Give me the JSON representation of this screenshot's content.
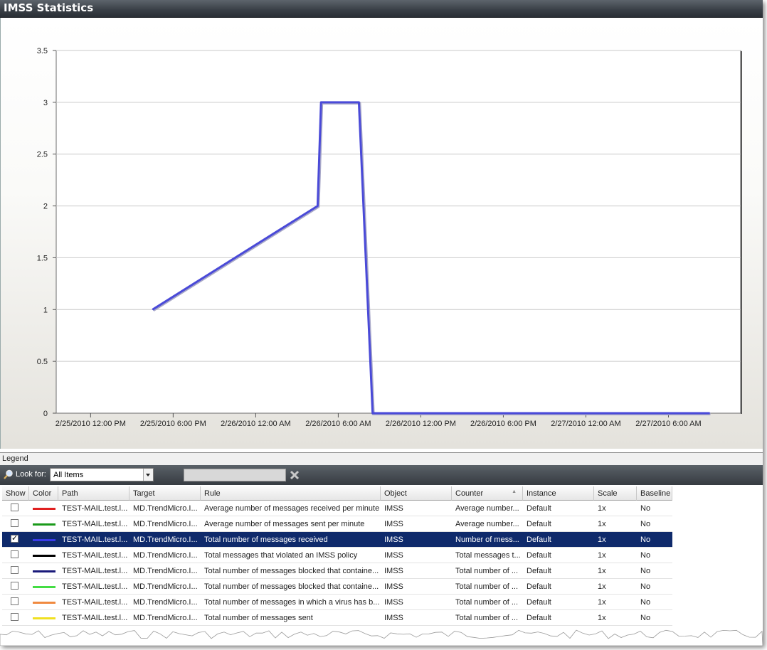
{
  "window": {
    "title": "IMSS Statistics"
  },
  "chart_data": {
    "type": "line",
    "ylim": [
      0,
      3.5
    ],
    "yticks": [
      "0",
      "0.5",
      "1",
      "1.5",
      "2",
      "2.5",
      "3",
      "3.5"
    ],
    "xticks": [
      "2/25/2010 12:00 PM",
      "2/25/2010 6:00 PM",
      "2/26/2010 12:00 AM",
      "2/26/2010 6:00 AM",
      "2/26/2010 12:00 PM",
      "2/26/2010 6:00 PM",
      "2/27/2010 12:00 AM",
      "2/27/2010 6:00 AM"
    ],
    "grid": true,
    "series": [
      {
        "color": "#4a4ad8",
        "points": [
          {
            "x": "2/25/2010 4:30 PM",
            "y": 1
          },
          {
            "x": "2/26/2010 4:30 AM",
            "y": 2
          },
          {
            "x": "2/26/2010 4:45 AM",
            "y": 3
          },
          {
            "x": "2/26/2010 7:30 AM",
            "y": 3
          },
          {
            "x": "2/26/2010 8:30 AM",
            "y": 0
          },
          {
            "x": "2/27/2010 9:00 AM",
            "y": 0
          }
        ]
      }
    ]
  },
  "legend": {
    "title": "Legend",
    "look_for_label": "Look for:",
    "filter_value": "All Items",
    "search_value": ""
  },
  "table": {
    "columns": [
      "Show",
      "Color",
      "Path",
      "Target",
      "Rule",
      "Object",
      "Counter",
      "Instance",
      "Scale",
      "Baseline"
    ],
    "rows": [
      {
        "show": false,
        "color": "#e02020",
        "path": "TEST-MAIL.test.l...",
        "target": "MD.TrendMicro.I...",
        "rule": "Average number of messages received per minute",
        "object": "IMSS",
        "counter": "Average number...",
        "instance": "Default",
        "scale": "1x",
        "baseline": "No"
      },
      {
        "show": false,
        "color": "#1a9a1a",
        "path": "TEST-MAIL.test.l...",
        "target": "MD.TrendMicro.I...",
        "rule": "Average number of messages sent per minute",
        "object": "IMSS",
        "counter": "Average number...",
        "instance": "Default",
        "scale": "1x",
        "baseline": "No"
      },
      {
        "show": true,
        "color": "#3a3ae8",
        "path": "TEST-MAIL.test.l...",
        "target": "MD.TrendMicro.I...",
        "rule": "Total number of messages received",
        "object": "IMSS",
        "counter": "Number of mess...",
        "instance": "Default",
        "scale": "1x",
        "baseline": "No"
      },
      {
        "show": false,
        "color": "#000000",
        "path": "TEST-MAIL.test.l...",
        "target": "MD.TrendMicro.I...",
        "rule": "Total messages that violated an IMSS policy",
        "object": "IMSS",
        "counter": "Total messages t...",
        "instance": "Default",
        "scale": "1x",
        "baseline": "No"
      },
      {
        "show": false,
        "color": "#1a1a7a",
        "path": "TEST-MAIL.test.l...",
        "target": "MD.TrendMicro.I...",
        "rule": "Total number of messages blocked that containe...",
        "object": "IMSS",
        "counter": "Total number of ...",
        "instance": "Default",
        "scale": "1x",
        "baseline": "No"
      },
      {
        "show": false,
        "color": "#44dd44",
        "path": "TEST-MAIL.test.l...",
        "target": "MD.TrendMicro.I...",
        "rule": "Total number of messages blocked that containe...",
        "object": "IMSS",
        "counter": "Total number of ...",
        "instance": "Default",
        "scale": "1x",
        "baseline": "No"
      },
      {
        "show": false,
        "color": "#f08a40",
        "path": "TEST-MAIL.test.l...",
        "target": "MD.TrendMicro.I...",
        "rule": "Total number of messages in which a virus has b...",
        "object": "IMSS",
        "counter": "Total number of ...",
        "instance": "Default",
        "scale": "1x",
        "baseline": "No"
      },
      {
        "show": false,
        "color": "#f0e020",
        "path": "TEST-MAIL.test.l...",
        "target": "MD.TrendMicro.I...",
        "rule": "Total number of messages sent",
        "object": "IMSS",
        "counter": "Total number of ...",
        "instance": "Default",
        "scale": "1x",
        "baseline": "No"
      }
    ]
  }
}
